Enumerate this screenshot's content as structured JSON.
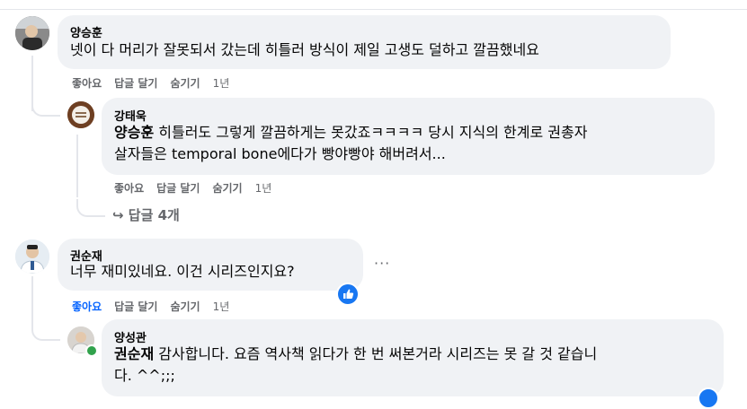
{
  "comments": [
    {
      "author": "양승훈",
      "text": "넷이 다 머리가 잘못되서 갔는데 히틀러 방식이 제일 고생도 덜하고 깔끔했네요",
      "actions": {
        "like": "좋아요",
        "reply": "답글 달기",
        "hide": "숨기기",
        "time": "1년"
      }
    },
    {
      "author": "강태욱",
      "mention": "양승훈",
      "text_line1": " 히틀러도 그렇게 깔끔하게는 못갔죠ㅋㅋㅋㅋ 당시 지식의 한계로 권총자",
      "text_line2": "살자들은 temporal bone에다가 빵야빵야 해버려서...",
      "actions": {
        "like": "좋아요",
        "reply": "답글 달기",
        "hide": "숨기기",
        "time": "1년"
      }
    },
    {
      "author": "권순재",
      "text": "너무 재미있네요. 이건 시리즈인지요?",
      "more": "···",
      "actions": {
        "like": "좋아요",
        "reply": "답글 달기",
        "hide": "숨기기",
        "time": "1년"
      },
      "like_color": "#0866ff"
    },
    {
      "author": "양성관",
      "mention": "권순재",
      "text_line1": " 감사합니다. 요즘 역사책 읽다가 한 번 써본거라 시리즈는 못 갈 것 같습니",
      "text_line2": "다. ^^;;;"
    }
  ],
  "view_replies": "↪ 답글 4개",
  "colors": {
    "bubble": "#f0f2f5",
    "meta": "#65676b",
    "accent": "#1877f2",
    "online": "#31a24c"
  }
}
